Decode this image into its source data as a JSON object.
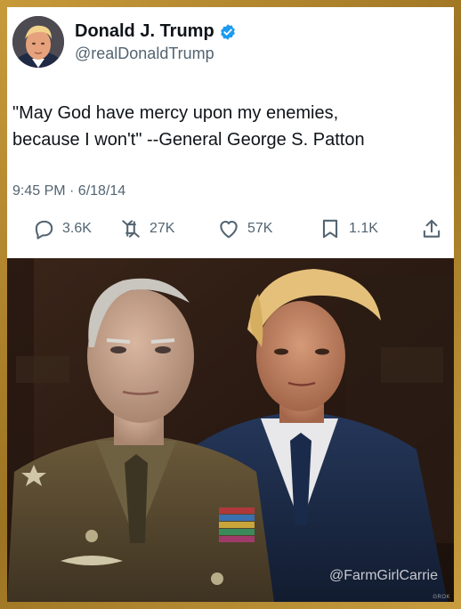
{
  "post": {
    "author_name": "Donald J. Trump",
    "handle": "@realDonaldTrump",
    "text_lines": [
      "\"May God have mercy upon my enemies,",
      "because I won't\" --General George S. Patton"
    ],
    "timestamp": "9:45 PM · 6/18/14",
    "metrics": {
      "replies": "3.6K",
      "reposts": "27K",
      "likes": "57K",
      "bookmarks": "1.1K"
    },
    "icons": [
      "reply-icon",
      "repost-icon",
      "like-icon",
      "bookmark-icon",
      "share-icon",
      "verified-badge-icon"
    ]
  },
  "image": {
    "watermark": "@FarmGirlCarrie",
    "ai_tag": "GROK"
  },
  "colors": {
    "frame": "#b58a2e",
    "verified": "#1d9bf0",
    "text": "#0f1419",
    "muted": "#536471"
  }
}
